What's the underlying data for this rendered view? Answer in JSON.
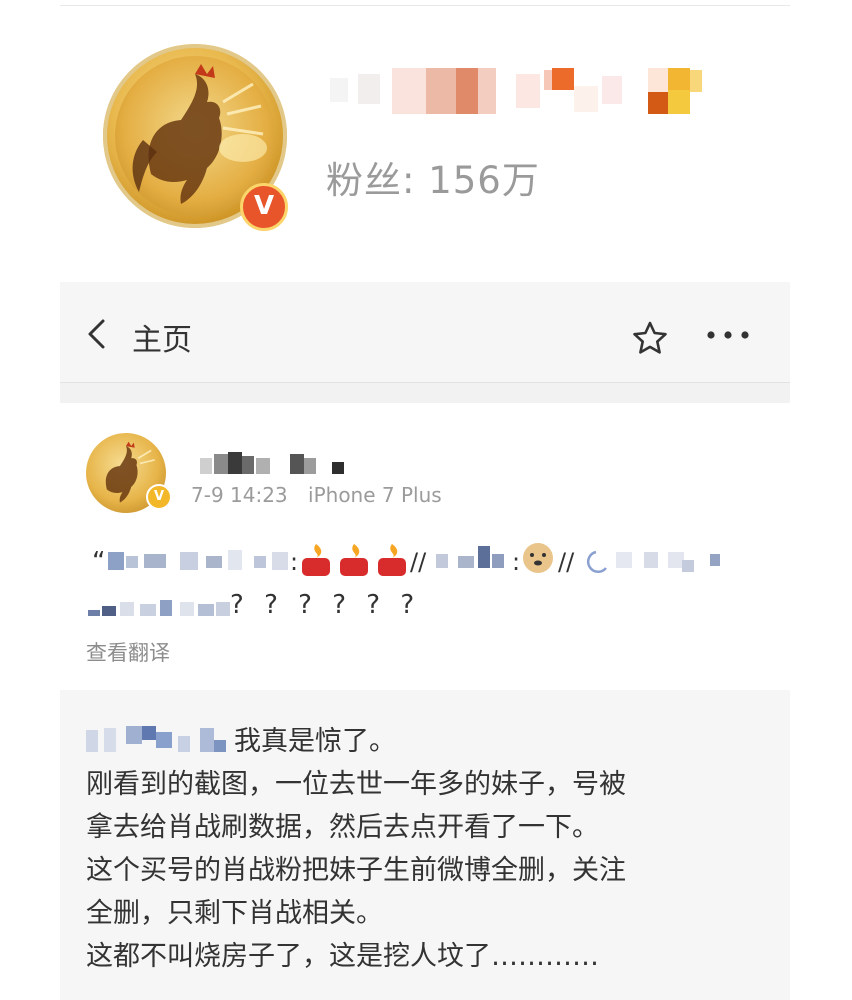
{
  "profile": {
    "fans_label": "粉丝: 156万",
    "verified_badge": "V"
  },
  "navbar": {
    "title": "主页"
  },
  "post": {
    "time": "7-9 14:23",
    "device": "iPhone 7 Plus",
    "question_marks": "? ? ? ? ? ?",
    "translate_label": "查看翻译",
    "repost_lines": [
      "我真是惊了。",
      "刚看到的截图，一位去世一年多的妹子，号被",
      "拿去给肖战刷数据，然后去点开看了一下。",
      "这个买号的肖战粉把妹子生前微博全删，关注",
      "全删，只剩下肖战相关。",
      "这都不叫烧房子了，这是挖人坟了…………"
    ]
  },
  "colors": {
    "badge": "#e8552a",
    "gold": "#e6b04a",
    "meta_gray": "#9b9b9b"
  }
}
